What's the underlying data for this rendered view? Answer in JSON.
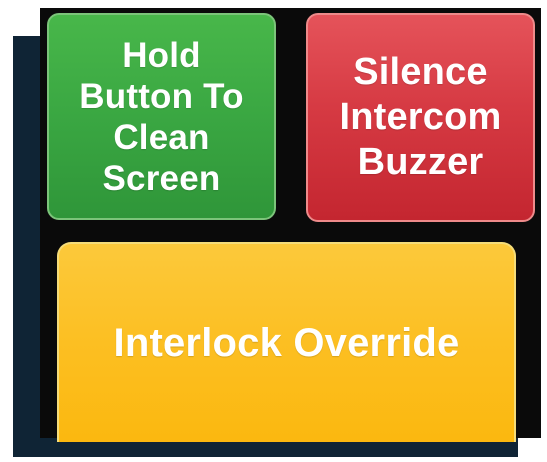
{
  "buttons": {
    "clean_screen": {
      "label": "Hold\nButton To\nClean\nScreen",
      "color": "#3aa742"
    },
    "silence_intercom": {
      "label": "Silence\nIntercom\nBuzzer",
      "color": "#d63a43"
    },
    "interlock_override": {
      "label": "Interlock Override",
      "color": "#fcbf22"
    }
  }
}
